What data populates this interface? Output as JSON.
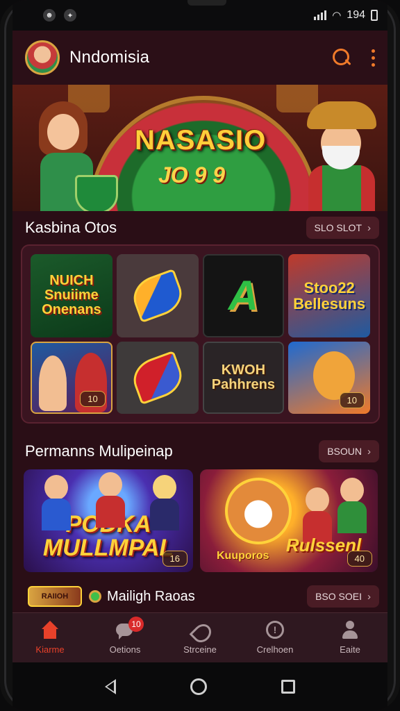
{
  "status_bar": {
    "time": "194",
    "left_icons": [
      "system-face-icon",
      "app-badge-icon"
    ]
  },
  "header": {
    "app_title": "Nndomisia"
  },
  "hero": {
    "title": "NASASIO",
    "numbers": "JO 9 9"
  },
  "section_slots": {
    "title": "Kasbina Otos",
    "action_label": "SLO SLOT"
  },
  "slot_games": [
    {
      "title": "NUICH Snuiime Onenans",
      "style": "green"
    },
    {
      "title": "",
      "style": "swirl-blue"
    },
    {
      "title": "A",
      "style": "letter"
    },
    {
      "title": "Stoo22 Bellesuns",
      "style": "blue"
    },
    {
      "title": "",
      "badge": "10",
      "style": "characters"
    },
    {
      "title": "",
      "style": "swirl-red"
    },
    {
      "title": "KWOH Pahhrens",
      "style": "dark"
    },
    {
      "title": "",
      "badge": "10",
      "style": "fox"
    }
  ],
  "section_multiplayer": {
    "title": "Permanns Mulipeinap",
    "action_label": "BSOUN"
  },
  "multiplayer_games": [
    {
      "title": "PODKA MULLMPAL",
      "badge": "16"
    },
    {
      "title": "Rulssenl",
      "subtitle": "Kuuporos",
      "badge": "40"
    }
  ],
  "live_row": {
    "thumb_label": "RAIIOH",
    "label": "Mailigh  Raoas",
    "action_label": "BSO SOEI"
  },
  "bottom_nav": [
    {
      "label": "Kiarme",
      "icon": "home-icon",
      "active": true
    },
    {
      "label": "Oetions",
      "icon": "chat-icon",
      "badge": "10",
      "active": false
    },
    {
      "label": "Strceine",
      "icon": "feather-icon",
      "active": false
    },
    {
      "label": "Crelhoen",
      "icon": "info-icon",
      "active": false
    },
    {
      "label": "Eaite",
      "icon": "user-icon",
      "active": false
    }
  ],
  "colors": {
    "accent": "#e8412a",
    "background": "#2a0e16",
    "gold": "#ffd23a"
  }
}
